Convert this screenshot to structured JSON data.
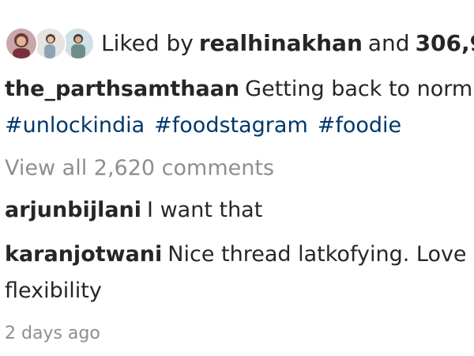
{
  "likes": {
    "prefix": "Liked by",
    "user": "realhinakhan",
    "conjunction": "and",
    "count": "306,9"
  },
  "caption": {
    "username": "the_parthsamthaan",
    "text": "Getting back to norma"
  },
  "hashtags": [
    "#unlockindia",
    "#foodstagram",
    "#foodie"
  ],
  "view_all": "View all 2,620 comments",
  "comments": [
    {
      "username": "arjunbijlani",
      "text": "I want that"
    },
    {
      "username": "karanjotwani",
      "text": "Nice thread latkofying. Love i",
      "text_continued": "flexibility"
    }
  ],
  "timestamp": "2 days ago",
  "colors": {
    "text": "#262626",
    "hashtag": "#00376b",
    "muted": "#8e8e8e"
  }
}
